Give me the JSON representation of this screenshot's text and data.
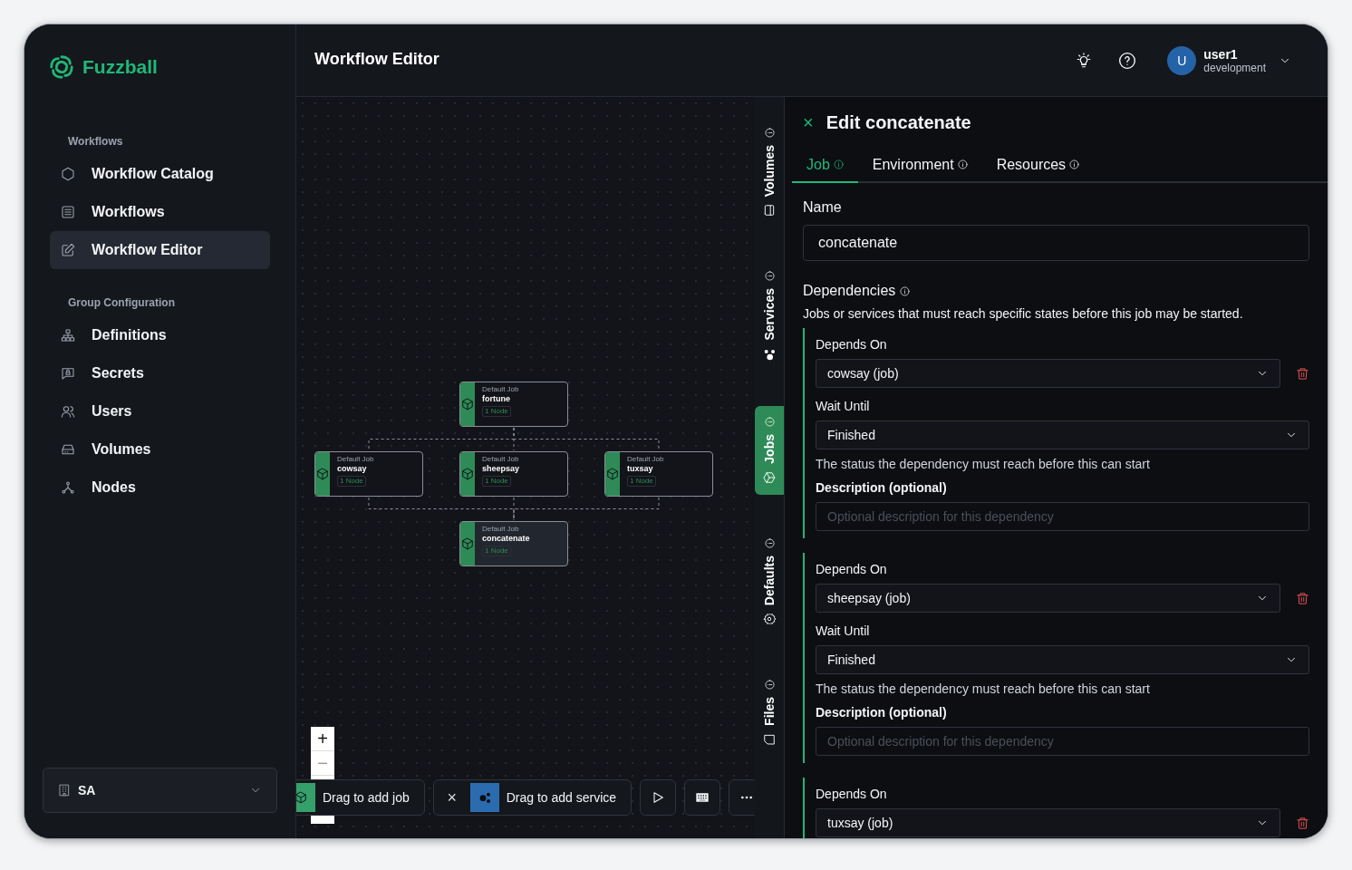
{
  "sidebar": {
    "logo": "Fuzzball",
    "sections": [
      {
        "title": "Workflows",
        "items": [
          {
            "label": "Workflow Catalog",
            "selected": false
          },
          {
            "label": "Workflows",
            "selected": false
          },
          {
            "label": "Workflow Editor",
            "selected": true
          }
        ]
      },
      {
        "title": "Group Configuration",
        "items": [
          {
            "label": "Definitions",
            "selected": false
          },
          {
            "label": "Secrets",
            "selected": false
          },
          {
            "label": "Users",
            "selected": false
          },
          {
            "label": "Volumes",
            "selected": false
          },
          {
            "label": "Nodes",
            "selected": false
          }
        ]
      }
    ],
    "organization": "SA"
  },
  "header": {
    "title": "Workflow Editor",
    "user": {
      "avatar": "U",
      "name": "user1",
      "environment": "development"
    }
  },
  "graph": {
    "levels": [
      [
        {
          "type": "Default Job",
          "name": "fortune",
          "badge": "1 Node",
          "selected": false
        }
      ],
      [
        {
          "type": "Default Job",
          "name": "cowsay",
          "badge": "1 Node",
          "selected": false
        },
        {
          "type": "Default Job",
          "name": "sheepsay",
          "badge": "1 Node",
          "selected": false
        },
        {
          "type": "Default Job",
          "name": "tuxsay",
          "badge": "1 Node",
          "selected": false
        }
      ],
      [
        {
          "type": "Default Job",
          "name": "concatenate",
          "badge": "1 Node",
          "selected": true
        }
      ]
    ]
  },
  "zoom": {
    "zoom_in": "+",
    "zoom_out": "−"
  },
  "toolbar": {
    "add_job": "Drag to add job",
    "close": "×",
    "add_service": "Drag to add service"
  },
  "side_tabs": [
    {
      "label": "Volumes",
      "selected": false
    },
    {
      "label": "Services",
      "selected": false
    },
    {
      "label": "Jobs",
      "selected": true
    },
    {
      "label": "Defaults",
      "selected": false
    },
    {
      "label": "Files",
      "selected": false
    }
  ],
  "panel": {
    "close": "×",
    "title": "Edit concatenate",
    "tabs": [
      {
        "label": "Job",
        "selected": true
      },
      {
        "label": "Environment",
        "selected": false
      },
      {
        "label": "Resources",
        "selected": false
      }
    ],
    "name": {
      "label": "Name",
      "value": "concatenate"
    },
    "dependencies": {
      "title": "Dependencies",
      "description": "Jobs or services that must reach specific states before this job may be started.",
      "items": [
        {
          "depends_label": "Depends On",
          "depends_value": "cowsay (job)",
          "wait_label": "Wait Until",
          "wait_value": "Finished",
          "hint": "The status the dependency must reach before this can start",
          "description_label": "Description (optional)",
          "description_placeholder": "Optional description for this dependency"
        },
        {
          "depends_label": "Depends On",
          "depends_value": "sheepsay (job)",
          "wait_label": "Wait Until",
          "wait_value": "Finished",
          "hint": "The status the dependency must reach before this can start",
          "description_label": "Description (optional)",
          "description_placeholder": "Optional description for this dependency"
        },
        {
          "depends_label": "Depends On",
          "depends_value": "tuxsay (job)"
        }
      ]
    }
  }
}
